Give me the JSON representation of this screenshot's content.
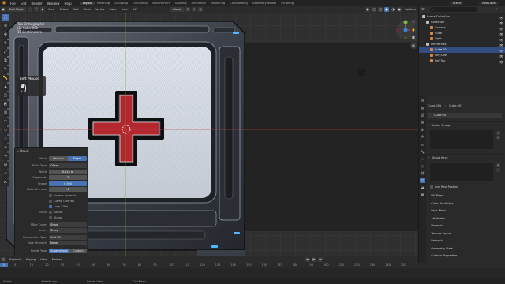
{
  "topbar": {
    "menus": [
      "File",
      "Edit",
      "Render",
      "Window",
      "Help"
    ],
    "workspaces": [
      "Layout",
      "Modeling",
      "Sculpting",
      "UV Editing",
      "Texture Paint",
      "Shading",
      "Animation",
      "Rendering",
      "Compositing",
      "Geometry Nodes",
      "Scripting"
    ],
    "active_workspace": "Layout",
    "scene": "Scene",
    "view_layer": "ViewLayer"
  },
  "viewport_header": {
    "mode": "Edit Mode",
    "menus": [
      "View",
      "Select",
      "Add",
      "Mesh",
      "Vertex",
      "Edge",
      "Face",
      "UV"
    ],
    "transform_orientation": "Global",
    "options": "Options"
  },
  "viewport_overlay": {
    "view_name": "Top Orthographic",
    "object_name": "(1) Cube.001",
    "scale": "10 Centimeters"
  },
  "mouse_hint": {
    "label": "Left Mouse"
  },
  "bevel_panel": {
    "title": "Bevel",
    "affect_label": "Affect",
    "affect_options": [
      "Vertices",
      "Edges"
    ],
    "affect_selected": "Edges",
    "width_type_label": "Width Type",
    "width_type": "Offset",
    "width_label": "Width",
    "width": "0.114 m",
    "segments_label": "Segments",
    "segments": "3",
    "shape_label": "Shape",
    "shape": "0.500",
    "material_label": "Material Index",
    "material": "-1",
    "harden_normals": "Harden Normals",
    "clamp_overlap": "Clamp Overlap",
    "loop_slide": "Loop Slide",
    "mark_label": "Mark",
    "seams": "Seams",
    "sharp": "Sharp",
    "miter_outer_label": "Miter Outer",
    "miter_outer": "Sharp",
    "inner_label": "Inner",
    "inner": "Sharp",
    "intersection_label": "Intersection Type",
    "intersection": "Grid Fill",
    "face_strength_label": "Face Strength",
    "face_strength": "None",
    "profile_type_label": "Profile Type",
    "profile_options": [
      "Superellipse",
      "Custom"
    ],
    "profile_selected": "Superellipse"
  },
  "timeline": {
    "menus": [
      "Playback",
      "Keying",
      "View",
      "Marker"
    ],
    "current_frame": "1",
    "ticks": [
      "0",
      "10",
      "20",
      "30",
      "40",
      "50",
      "60",
      "70",
      "80",
      "90",
      "100",
      "110",
      "120",
      "130",
      "140",
      "150",
      "160",
      "170",
      "180",
      "190",
      "200",
      "210",
      "220",
      "230",
      "240",
      "250"
    ]
  },
  "statusbar": {
    "items": [
      "Select",
      "Select Loop",
      "Rotate View",
      "Call Menu"
    ]
  },
  "outliner": {
    "rows": [
      {
        "label": "Scene Collection",
        "indent": 0,
        "selected": false,
        "color": "#bdbdbd"
      },
      {
        "label": "Collection",
        "indent": 1,
        "selected": false,
        "color": "#bdbdbd"
      },
      {
        "label": "Camera",
        "indent": 2,
        "selected": false,
        "color": "#d58a4a"
      },
      {
        "label": "Cube",
        "indent": 2,
        "selected": false,
        "color": "#d58a4a"
      },
      {
        "label": "Light",
        "indent": 2,
        "selected": false,
        "color": "#d58a4a"
      },
      {
        "label": "References",
        "indent": 1,
        "selected": false,
        "color": "#bdbdbd"
      },
      {
        "label": "Cube.001",
        "indent": 2,
        "selected": true,
        "color": "#d58a4a"
      },
      {
        "label": "Ref_Side",
        "indent": 2,
        "selected": false,
        "color": "#d58a4a"
      },
      {
        "label": "Ref_Top",
        "indent": 2,
        "selected": false,
        "color": "#d58a4a"
      }
    ]
  },
  "properties": {
    "breadcrumb_object": "Cube.001",
    "breadcrumb_data": "Cube.001",
    "data_name": "Cube.001",
    "vertex_groups": "Vertex Groups",
    "shape_keys": "Shape Keys",
    "add_rest_position": "Add Rest Position",
    "sections": [
      "UV Maps",
      "Color Attributes",
      "Face Maps",
      "Attributes",
      "Normals",
      "Texture Space",
      "Remesh",
      "Geometry Data",
      "Custom Properties"
    ]
  },
  "colors": {
    "accent": "#4772b3",
    "cross_red": "#b3282e",
    "x_axis": "#c8404a"
  }
}
